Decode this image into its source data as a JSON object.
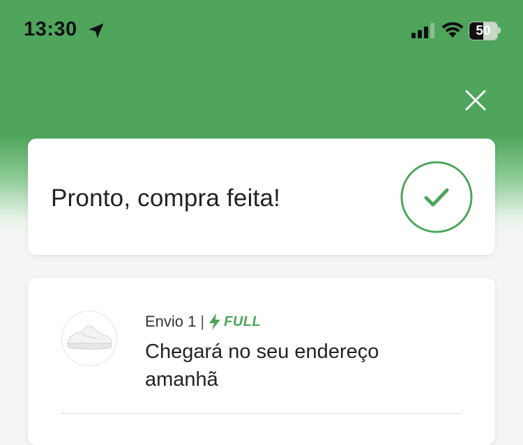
{
  "status_bar": {
    "time": "13:30",
    "battery_level": "50",
    "battery_percent": 50,
    "icons": [
      "location-arrow-icon",
      "cellular-signal-icon",
      "wifi-icon",
      "battery-icon"
    ]
  },
  "header": {
    "close_icon": "close-icon"
  },
  "confirmation": {
    "title": "Pronto, compra feita!",
    "icon": "check-circle-icon"
  },
  "shipment": {
    "label": "Envio 1",
    "separator": "|",
    "badge_icon": "lightning-bolt-icon",
    "badge": "FULL",
    "delivery": "Chegará no seu endereço amanhã",
    "product_icon": "sneaker-image"
  },
  "colors": {
    "brand_green": "#4ea55b",
    "background": "#f5f5f5",
    "card": "#ffffff"
  }
}
